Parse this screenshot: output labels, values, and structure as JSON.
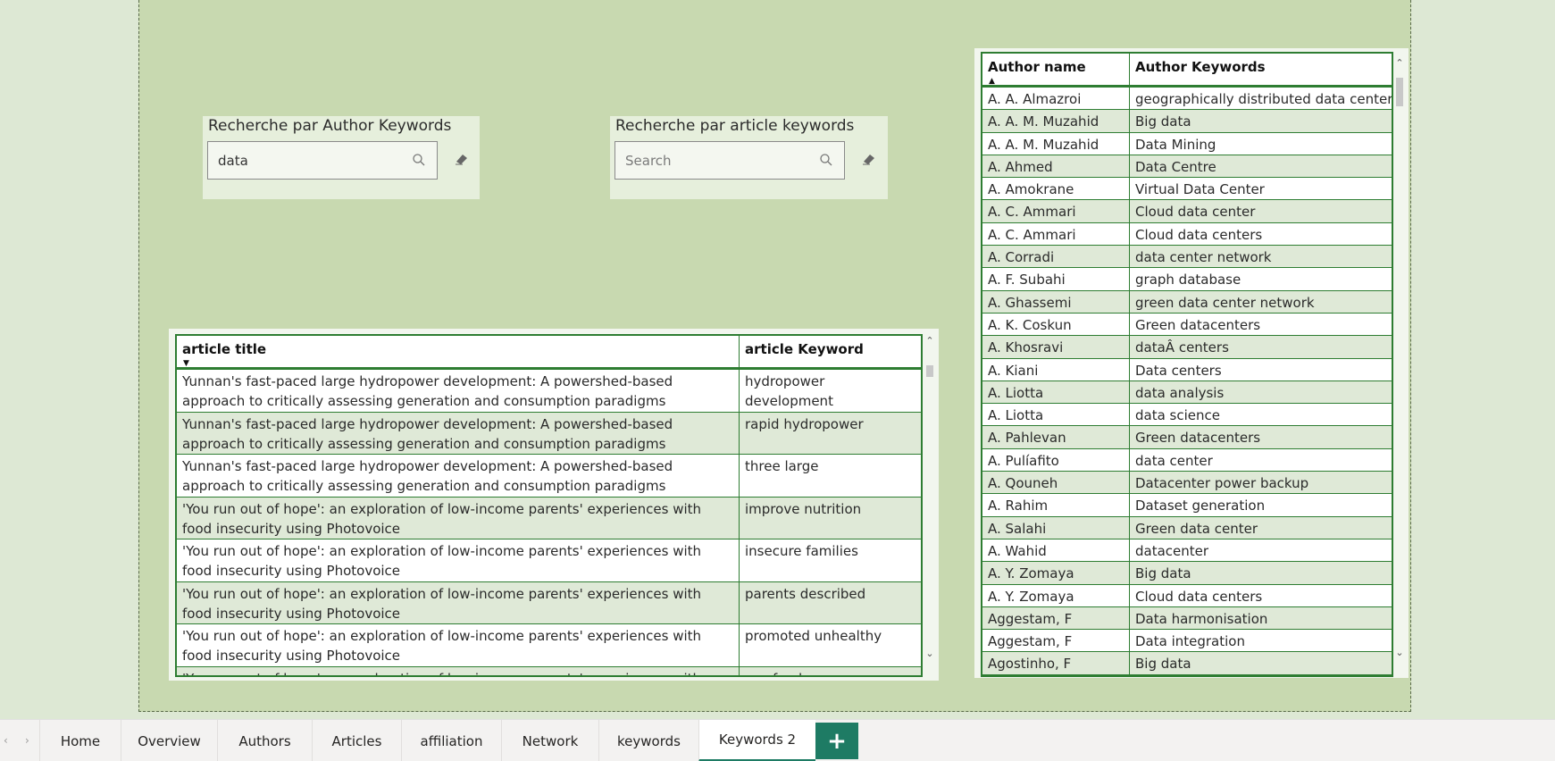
{
  "slicer_author": {
    "title": "Recherche par Author Keywords",
    "value": "data"
  },
  "slicer_article": {
    "title": "Recherche par article keywords",
    "placeholder": "Search"
  },
  "articles_table": {
    "headers": [
      "article title",
      "article Keyword"
    ],
    "sort_indicator": "▼",
    "rows": [
      {
        "title": "Yunnan's fast-paced large hydropower development: A powershed-based approach to critically assessing generation and consumption paradigms",
        "keyword": "hydropower development"
      },
      {
        "title": "Yunnan's fast-paced large hydropower development: A powershed-based approach to critically assessing generation and consumption paradigms",
        "keyword": "rapid hydropower"
      },
      {
        "title": "Yunnan's fast-paced large hydropower development: A powershed-based approach to critically assessing generation and consumption paradigms",
        "keyword": "three large"
      },
      {
        "title": "'You run out of hope': an exploration of low-income parents' experiences with food insecurity using Photovoice",
        "keyword": "improve nutrition"
      },
      {
        "title": "'You run out of hope': an exploration of low-income parents' experiences with food insecurity using Photovoice",
        "keyword": "insecure families"
      },
      {
        "title": "'You run out of hope': an exploration of low-income parents' experiences with food insecurity using Photovoice",
        "keyword": "parents described"
      },
      {
        "title": "'You run out of hope': an exploration of low-income parents' experiences with food insecurity using Photovoice",
        "keyword": "promoted unhealthy"
      },
      {
        "title": "'You run out of hope': an exploration of low-income parents' experiences with food insecurity using Photovoice",
        "keyword": "see food"
      }
    ]
  },
  "authors_table": {
    "headers": [
      "Author name",
      "Author Keywords"
    ],
    "sort_indicator": "▲",
    "rows": [
      {
        "name": "A. A. Almazroi",
        "keyword": "geographically distributed data centers"
      },
      {
        "name": "A. A. M. Muzahid",
        "keyword": "Big data"
      },
      {
        "name": "A. A. M. Muzahid",
        "keyword": "Data Mining"
      },
      {
        "name": "A. Ahmed",
        "keyword": "Data Centre"
      },
      {
        "name": "A. Amokrane",
        "keyword": "Virtual Data Center"
      },
      {
        "name": "A. C. Ammari",
        "keyword": "Cloud data center"
      },
      {
        "name": "A. C. Ammari",
        "keyword": "Cloud data centers"
      },
      {
        "name": "A. Corradi",
        "keyword": "data center network"
      },
      {
        "name": "A. F. Subahi",
        "keyword": "graph database"
      },
      {
        "name": "A. Ghassemi",
        "keyword": "green data center network"
      },
      {
        "name": "A. K. Coskun",
        "keyword": "Green datacenters"
      },
      {
        "name": "A. Khosravi",
        "keyword": "dataÂ centers"
      },
      {
        "name": "A. Kiani",
        "keyword": "Data centers"
      },
      {
        "name": "A. Liotta",
        "keyword": "data analysis"
      },
      {
        "name": "A. Liotta",
        "keyword": "data science"
      },
      {
        "name": "A. Pahlevan",
        "keyword": "Green datacenters"
      },
      {
        "name": "A. Pulíafito",
        "keyword": "data center"
      },
      {
        "name": "A. Qouneh",
        "keyword": "Datacenter power backup"
      },
      {
        "name": "A. Rahim",
        "keyword": "Dataset generation"
      },
      {
        "name": "A. Salahi",
        "keyword": "Green data center"
      },
      {
        "name": "A. Wahid",
        "keyword": "datacenter"
      },
      {
        "name": "A. Y. Zomaya",
        "keyword": "Big data"
      },
      {
        "name": "A. Y. Zomaya",
        "keyword": "Cloud data centers"
      },
      {
        "name": "Aggestam, F",
        "keyword": "Data harmonisation"
      },
      {
        "name": "Aggestam, F",
        "keyword": "Data integration"
      },
      {
        "name": "Agostinho, F",
        "keyword": "Big data"
      }
    ]
  },
  "tabs": [
    {
      "label": "Home",
      "active": false
    },
    {
      "label": "Overview",
      "active": false
    },
    {
      "label": "Authors",
      "active": false
    },
    {
      "label": "Articles",
      "active": false
    },
    {
      "label": "affiliation",
      "active": false
    },
    {
      "label": "Network",
      "active": false
    },
    {
      "label": "keywords",
      "active": false
    },
    {
      "label": "Keywords 2",
      "active": true
    }
  ],
  "add_tab": "+",
  "colors": {
    "canvas": "#c8d9b0",
    "table_border": "#2e7d32",
    "accent": "#1e7b64"
  }
}
